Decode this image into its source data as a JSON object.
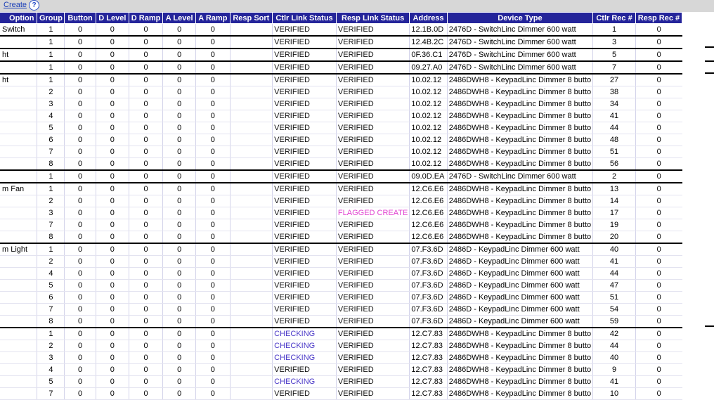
{
  "toolbar": {
    "create_label": "Create",
    "help_glyph": "?",
    "help_icon": "help-icon"
  },
  "columns": [
    "Option",
    "Group",
    "Button",
    "D Level",
    "D Ramp",
    "A Level",
    "A Ramp",
    "Resp Sort",
    "Ctlr Link Status",
    "Resp Link Status",
    "Address",
    "Device Type",
    "Ctlr Rec #",
    "Resp Rec #"
  ],
  "status_colors": {
    "VERIFIED": "#111111",
    "CHECKING": "#4a38c8",
    "FLAGGED CREATE": "#e040d0"
  },
  "rows": [
    {
      "name": "Switch",
      "group": "1",
      "button": "0",
      "dlevel": "0",
      "dramp": "0",
      "alevel": "0",
      "aramp": "0",
      "sort": "",
      "ctlr": "VERIFIED",
      "resp": "VERIFIED",
      "address": "12.1B.0D",
      "device": "2476D - SwitchLinc Dimmer 600 watt",
      "ctlr_rec": "1",
      "resp_rec": "0",
      "sep": false
    },
    {
      "name": "",
      "group": "1",
      "button": "0",
      "dlevel": "0",
      "dramp": "0",
      "alevel": "0",
      "aramp": "0",
      "sort": "",
      "ctlr": "VERIFIED",
      "resp": "VERIFIED",
      "address": "12.4B.2C",
      "device": "2476D - SwitchLinc Dimmer 600 watt",
      "ctlr_rec": "3",
      "resp_rec": "0",
      "sep": true
    },
    {
      "name": "ht",
      "group": "1",
      "button": "0",
      "dlevel": "0",
      "dramp": "0",
      "alevel": "0",
      "aramp": "0",
      "sort": "",
      "ctlr": "VERIFIED",
      "resp": "VERIFIED",
      "address": "0F.36.C1",
      "device": "2476D - SwitchLinc Dimmer 600 watt",
      "ctlr_rec": "5",
      "resp_rec": "0",
      "sep": true
    },
    {
      "name": "",
      "group": "1",
      "button": "0",
      "dlevel": "0",
      "dramp": "0",
      "alevel": "0",
      "aramp": "0",
      "sort": "",
      "ctlr": "VERIFIED",
      "resp": "VERIFIED",
      "address": "09.27.A0",
      "device": "2476D - SwitchLinc Dimmer 600 watt",
      "ctlr_rec": "7",
      "resp_rec": "0",
      "sep": true
    },
    {
      "name": "ht",
      "group": "1",
      "button": "0",
      "dlevel": "0",
      "dramp": "0",
      "alevel": "0",
      "aramp": "0",
      "sort": "",
      "ctlr": "VERIFIED",
      "resp": "VERIFIED",
      "address": "10.02.12",
      "device": "2486DWH8 - KeypadLinc Dimmer 8 butto",
      "ctlr_rec": "27",
      "resp_rec": "0",
      "sep": true
    },
    {
      "name": "",
      "group": "2",
      "button": "0",
      "dlevel": "0",
      "dramp": "0",
      "alevel": "0",
      "aramp": "0",
      "sort": "",
      "ctlr": "VERIFIED",
      "resp": "VERIFIED",
      "address": "10.02.12",
      "device": "2486DWH8 - KeypadLinc Dimmer 8 butto",
      "ctlr_rec": "38",
      "resp_rec": "0",
      "sep": false
    },
    {
      "name": "",
      "group": "3",
      "button": "0",
      "dlevel": "0",
      "dramp": "0",
      "alevel": "0",
      "aramp": "0",
      "sort": "",
      "ctlr": "VERIFIED",
      "resp": "VERIFIED",
      "address": "10.02.12",
      "device": "2486DWH8 - KeypadLinc Dimmer 8 butto",
      "ctlr_rec": "34",
      "resp_rec": "0",
      "sep": false
    },
    {
      "name": "",
      "group": "4",
      "button": "0",
      "dlevel": "0",
      "dramp": "0",
      "alevel": "0",
      "aramp": "0",
      "sort": "",
      "ctlr": "VERIFIED",
      "resp": "VERIFIED",
      "address": "10.02.12",
      "device": "2486DWH8 - KeypadLinc Dimmer 8 butto",
      "ctlr_rec": "41",
      "resp_rec": "0",
      "sep": false
    },
    {
      "name": "",
      "group": "5",
      "button": "0",
      "dlevel": "0",
      "dramp": "0",
      "alevel": "0",
      "aramp": "0",
      "sort": "",
      "ctlr": "VERIFIED",
      "resp": "VERIFIED",
      "address": "10.02.12",
      "device": "2486DWH8 - KeypadLinc Dimmer 8 butto",
      "ctlr_rec": "44",
      "resp_rec": "0",
      "sep": false
    },
    {
      "name": "",
      "group": "6",
      "button": "0",
      "dlevel": "0",
      "dramp": "0",
      "alevel": "0",
      "aramp": "0",
      "sort": "",
      "ctlr": "VERIFIED",
      "resp": "VERIFIED",
      "address": "10.02.12",
      "device": "2486DWH8 - KeypadLinc Dimmer 8 butto",
      "ctlr_rec": "48",
      "resp_rec": "0",
      "sep": false
    },
    {
      "name": "",
      "group": "7",
      "button": "0",
      "dlevel": "0",
      "dramp": "0",
      "alevel": "0",
      "aramp": "0",
      "sort": "",
      "ctlr": "VERIFIED",
      "resp": "VERIFIED",
      "address": "10.02.12",
      "device": "2486DWH8 - KeypadLinc Dimmer 8 butto",
      "ctlr_rec": "51",
      "resp_rec": "0",
      "sep": false
    },
    {
      "name": "",
      "group": "8",
      "button": "0",
      "dlevel": "0",
      "dramp": "0",
      "alevel": "0",
      "aramp": "0",
      "sort": "",
      "ctlr": "VERIFIED",
      "resp": "VERIFIED",
      "address": "10.02.12",
      "device": "2486DWH8 - KeypadLinc Dimmer 8 butto",
      "ctlr_rec": "56",
      "resp_rec": "0",
      "sep": false
    },
    {
      "name": "",
      "group": "1",
      "button": "0",
      "dlevel": "0",
      "dramp": "0",
      "alevel": "0",
      "aramp": "0",
      "sort": "",
      "ctlr": "VERIFIED",
      "resp": "VERIFIED",
      "address": "09.0D.EA",
      "device": "2476D - SwitchLinc Dimmer 600 watt",
      "ctlr_rec": "2",
      "resp_rec": "0",
      "sep": true
    },
    {
      "name": "m Fan",
      "group": "1",
      "button": "0",
      "dlevel": "0",
      "dramp": "0",
      "alevel": "0",
      "aramp": "0",
      "sort": "",
      "ctlr": "VERIFIED",
      "resp": "VERIFIED",
      "address": "12.C6.E6",
      "device": "2486DWH8 - KeypadLinc Dimmer 8 butto",
      "ctlr_rec": "13",
      "resp_rec": "0",
      "sep": true
    },
    {
      "name": "",
      "group": "2",
      "button": "0",
      "dlevel": "0",
      "dramp": "0",
      "alevel": "0",
      "aramp": "0",
      "sort": "",
      "ctlr": "VERIFIED",
      "resp": "VERIFIED",
      "address": "12.C6.E6",
      "device": "2486DWH8 - KeypadLinc Dimmer 8 butto",
      "ctlr_rec": "14",
      "resp_rec": "0",
      "sep": false
    },
    {
      "name": "",
      "group": "3",
      "button": "0",
      "dlevel": "0",
      "dramp": "0",
      "alevel": "0",
      "aramp": "0",
      "sort": "",
      "ctlr": "VERIFIED",
      "resp": "FLAGGED CREATE",
      "address": "12.C6.E6",
      "device": "2486DWH8 - KeypadLinc Dimmer 8 butto",
      "ctlr_rec": "17",
      "resp_rec": "0",
      "sep": false
    },
    {
      "name": "",
      "group": "7",
      "button": "0",
      "dlevel": "0",
      "dramp": "0",
      "alevel": "0",
      "aramp": "0",
      "sort": "",
      "ctlr": "VERIFIED",
      "resp": "VERIFIED",
      "address": "12.C6.E6",
      "device": "2486DWH8 - KeypadLinc Dimmer 8 butto",
      "ctlr_rec": "19",
      "resp_rec": "0",
      "sep": false
    },
    {
      "name": "",
      "group": "8",
      "button": "0",
      "dlevel": "0",
      "dramp": "0",
      "alevel": "0",
      "aramp": "0",
      "sort": "",
      "ctlr": "VERIFIED",
      "resp": "VERIFIED",
      "address": "12.C6.E6",
      "device": "2486DWH8 - KeypadLinc Dimmer 8 butto",
      "ctlr_rec": "20",
      "resp_rec": "0",
      "sep": false
    },
    {
      "name": "m Light",
      "group": "1",
      "button": "0",
      "dlevel": "0",
      "dramp": "0",
      "alevel": "0",
      "aramp": "0",
      "sort": "",
      "ctlr": "VERIFIED",
      "resp": "VERIFIED",
      "address": "07.F3.6D",
      "device": "2486D - KeypadLinc Dimmer 600 watt",
      "ctlr_rec": "40",
      "resp_rec": "0",
      "sep": true
    },
    {
      "name": "",
      "group": "2",
      "button": "0",
      "dlevel": "0",
      "dramp": "0",
      "alevel": "0",
      "aramp": "0",
      "sort": "",
      "ctlr": "VERIFIED",
      "resp": "VERIFIED",
      "address": "07.F3.6D",
      "device": "2486D - KeypadLinc Dimmer 600 watt",
      "ctlr_rec": "41",
      "resp_rec": "0",
      "sep": false
    },
    {
      "name": "",
      "group": "4",
      "button": "0",
      "dlevel": "0",
      "dramp": "0",
      "alevel": "0",
      "aramp": "0",
      "sort": "",
      "ctlr": "VERIFIED",
      "resp": "VERIFIED",
      "address": "07.F3.6D",
      "device": "2486D - KeypadLinc Dimmer 600 watt",
      "ctlr_rec": "44",
      "resp_rec": "0",
      "sep": false
    },
    {
      "name": "",
      "group": "5",
      "button": "0",
      "dlevel": "0",
      "dramp": "0",
      "alevel": "0",
      "aramp": "0",
      "sort": "",
      "ctlr": "VERIFIED",
      "resp": "VERIFIED",
      "address": "07.F3.6D",
      "device": "2486D - KeypadLinc Dimmer 600 watt",
      "ctlr_rec": "47",
      "resp_rec": "0",
      "sep": false
    },
    {
      "name": "",
      "group": "6",
      "button": "0",
      "dlevel": "0",
      "dramp": "0",
      "alevel": "0",
      "aramp": "0",
      "sort": "",
      "ctlr": "VERIFIED",
      "resp": "VERIFIED",
      "address": "07.F3.6D",
      "device": "2486D - KeypadLinc Dimmer 600 watt",
      "ctlr_rec": "51",
      "resp_rec": "0",
      "sep": false
    },
    {
      "name": "",
      "group": "7",
      "button": "0",
      "dlevel": "0",
      "dramp": "0",
      "alevel": "0",
      "aramp": "0",
      "sort": "",
      "ctlr": "VERIFIED",
      "resp": "VERIFIED",
      "address": "07.F3.6D",
      "device": "2486D - KeypadLinc Dimmer 600 watt",
      "ctlr_rec": "54",
      "resp_rec": "0",
      "sep": false
    },
    {
      "name": "",
      "group": "8",
      "button": "0",
      "dlevel": "0",
      "dramp": "0",
      "alevel": "0",
      "aramp": "0",
      "sort": "",
      "ctlr": "VERIFIED",
      "resp": "VERIFIED",
      "address": "07.F3.6D",
      "device": "2486D - KeypadLinc Dimmer 600 watt",
      "ctlr_rec": "59",
      "resp_rec": "0",
      "sep": false
    },
    {
      "name": "",
      "group": "1",
      "button": "0",
      "dlevel": "0",
      "dramp": "0",
      "alevel": "0",
      "aramp": "0",
      "sort": "",
      "ctlr": "CHECKING",
      "resp": "VERIFIED",
      "address": "12.C7.83",
      "device": "2486DWH8 - KeypadLinc Dimmer 8 butto",
      "ctlr_rec": "42",
      "resp_rec": "0",
      "sep": true
    },
    {
      "name": "",
      "group": "2",
      "button": "0",
      "dlevel": "0",
      "dramp": "0",
      "alevel": "0",
      "aramp": "0",
      "sort": "",
      "ctlr": "CHECKING",
      "resp": "VERIFIED",
      "address": "12.C7.83",
      "device": "2486DWH8 - KeypadLinc Dimmer 8 butto",
      "ctlr_rec": "44",
      "resp_rec": "0",
      "sep": false
    },
    {
      "name": "",
      "group": "3",
      "button": "0",
      "dlevel": "0",
      "dramp": "0",
      "alevel": "0",
      "aramp": "0",
      "sort": "",
      "ctlr": "CHECKING",
      "resp": "VERIFIED",
      "address": "12.C7.83",
      "device": "2486DWH8 - KeypadLinc Dimmer 8 butto",
      "ctlr_rec": "40",
      "resp_rec": "0",
      "sep": false
    },
    {
      "name": "",
      "group": "4",
      "button": "0",
      "dlevel": "0",
      "dramp": "0",
      "alevel": "0",
      "aramp": "0",
      "sort": "",
      "ctlr": "VERIFIED",
      "resp": "VERIFIED",
      "address": "12.C7.83",
      "device": "2486DWH8 - KeypadLinc Dimmer 8 butto",
      "ctlr_rec": "9",
      "resp_rec": "0",
      "sep": false
    },
    {
      "name": "",
      "group": "5",
      "button": "0",
      "dlevel": "0",
      "dramp": "0",
      "alevel": "0",
      "aramp": "0",
      "sort": "",
      "ctlr": "CHECKING",
      "resp": "VERIFIED",
      "address": "12.C7.83",
      "device": "2486DWH8 - KeypadLinc Dimmer 8 butto",
      "ctlr_rec": "41",
      "resp_rec": "0",
      "sep": false
    },
    {
      "name": "",
      "group": "7",
      "button": "0",
      "dlevel": "0",
      "dramp": "0",
      "alevel": "0",
      "aramp": "0",
      "sort": "",
      "ctlr": "VERIFIED",
      "resp": "VERIFIED",
      "address": "12.C7.83",
      "device": "2486DWH8 - KeypadLinc Dimmer 8 butto",
      "ctlr_rec": "10",
      "resp_rec": "0",
      "sep": false
    }
  ]
}
